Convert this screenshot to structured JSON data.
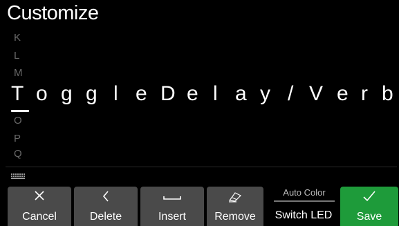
{
  "header": {
    "title": "Customize"
  },
  "char_roller": {
    "above": [
      "K",
      "L",
      "M"
    ],
    "below": [
      "O",
      "P",
      "Q"
    ]
  },
  "name_field": {
    "chars": [
      "T",
      "o",
      "g",
      "g",
      "l",
      "e",
      "D",
      "e",
      "l",
      "a",
      "y",
      "/",
      "V",
      "e",
      "r",
      "b"
    ],
    "cursor_index": 0
  },
  "bottom_bar": {
    "cancel_label": "Cancel",
    "delete_label": "Delete",
    "insert_label": "Insert",
    "remove_label": "Remove",
    "auto_color_label": "Auto Color",
    "switch_led_label": "Switch LED",
    "save_label": "Save"
  },
  "icons": {
    "cancel": "close-icon",
    "delete": "chevron-left-icon",
    "insert": "space-icon",
    "remove": "eraser-icon",
    "save": "checkmark-icon",
    "keyboard": "keyboard-icon"
  },
  "colors": {
    "background": "#000000",
    "button": "#4a4a4a",
    "save": "#1e9b3a",
    "roller_text": "#6a6a6a"
  }
}
